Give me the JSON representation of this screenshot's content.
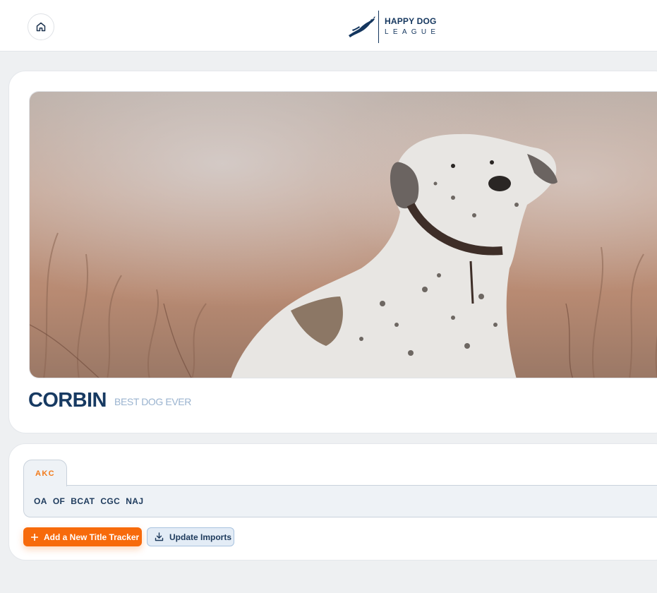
{
  "header": {
    "home_icon": "home-icon",
    "logo": {
      "line1": "HAPPY DOG",
      "line2": "LEAGUE"
    }
  },
  "profile": {
    "photo": "dog-photo",
    "name": "CORBIN",
    "tagline": "BEST DOG EVER"
  },
  "titles": {
    "tabs": [
      {
        "label": "AKC",
        "active": true
      }
    ],
    "earned": [
      "OA",
      "OF",
      "BCAT",
      "CGC",
      "NAJ"
    ],
    "add_button": "Add a New Title Tracker",
    "update_button": "Update Imports"
  },
  "colors": {
    "brand_navy": "#173a62",
    "accent_orange": "#f76a0b",
    "tagline_blue": "#9ab3cf"
  }
}
